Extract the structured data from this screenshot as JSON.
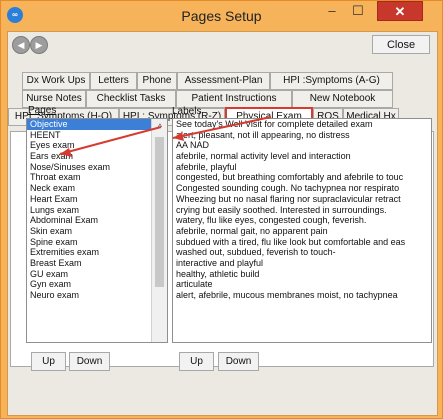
{
  "window": {
    "title": "Pages Setup",
    "app_icon": "app-logo-icon",
    "min_glyph": "–",
    "max_glyph": "☐",
    "close_glyph": "✕"
  },
  "toolbar": {
    "back_glyph": "◀",
    "forward_glyph": "▶",
    "close_label": "Close"
  },
  "tabs": {
    "row1": [
      "Dx Work Ups",
      "Letters",
      "Phone",
      "Assessment-Plan",
      "HPI :Symptoms (A-G)"
    ],
    "row2": [
      "Nurse Notes",
      "Checklist Tasks",
      "Patient Instructions",
      "New Notebook"
    ],
    "row3": [
      "HPI :Symptoms (H-Q)",
      "HPI : Symptoms (R-Z)",
      "Physical Exam",
      "ROS",
      "Medical Hx"
    ],
    "active": "Physical Exam"
  },
  "pages": {
    "header": "Pages",
    "selected": "Objective",
    "items": [
      "Objective",
      "HEENT",
      "Eyes exam",
      "Ears exam",
      "Nose/Sinuses exam",
      "Throat exam",
      "Neck exam",
      "Heart Exam",
      "Lungs exam",
      "Abdominal Exam",
      "Skin exam",
      "Spine exam",
      "Extremities exam",
      "Breast Exam",
      "GU exam",
      "Gyn exam",
      "Neuro exam"
    ]
  },
  "labels": {
    "header": "Labels",
    "items": [
      "See today's Well Visit for complete detailed exam",
      "alert, pleasant, not ill appearing, no distress",
      "AA NAD",
      "afebrile, normal activity level and interaction",
      "afebrile, playful",
      "congested, but breathing comfortably and afebrile to touc",
      "Congested sounding cough.  No tachypnea nor respirato",
      "Wheezing but no nasal flaring nor supraclavicular retract",
      "crying but easily soothed. Interested in surroundings.",
      "watery, flu like eyes,  congested cough, feverish.",
      "afebrile, normal gait, no apparent pain",
      "subdued with a tired, flu like look but comfortable and eas",
      "washed out, subdued, feverish to touch-",
      "interactive and playful",
      "healthy, athletic build",
      "articulate",
      "alert, afebrile, mucous membranes moist, no tachypnea"
    ]
  },
  "buttons": {
    "up": "Up",
    "down": "Down"
  },
  "colors": {
    "title_bar": "#f6b35a",
    "selection": "#3b7fd6",
    "annotation_red": "#d53b30",
    "close_red": "#c7372c"
  }
}
